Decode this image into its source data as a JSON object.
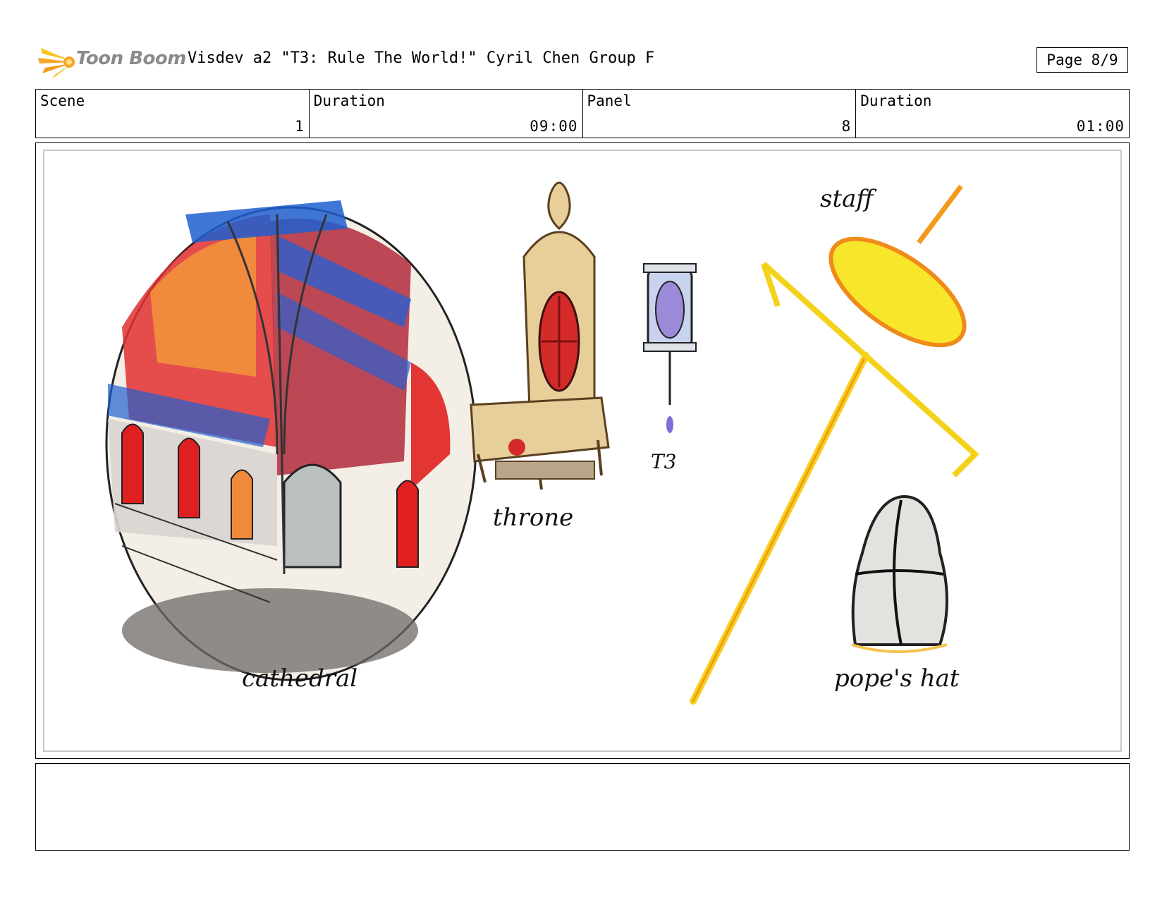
{
  "header": {
    "logo_text": "Toon Boom",
    "title": "Visdev a2 \"T3: Rule The World!\" Cyril Chen Group F",
    "page": "Page 8/9"
  },
  "info": {
    "scene_label": "Scene",
    "scene_value": "1",
    "scene_duration_label": "Duration",
    "scene_duration_value": "09:00",
    "panel_label": "Panel",
    "panel_value": "8",
    "panel_duration_label": "Duration",
    "panel_duration_value": "01:00"
  },
  "panel": {
    "labels": {
      "cathedral": "cathedral",
      "throne": "throne",
      "t3": "T3",
      "staff": "staff",
      "popes_hat": "pope's hat"
    }
  },
  "colors": {
    "logo_orange": "#f5a623",
    "logo_text": "#8a8a8a",
    "stained_red": "#e02020",
    "stained_blue": "#1f5fd0",
    "gold": "#f5d21a",
    "panel_border": "#c9c9c9"
  }
}
